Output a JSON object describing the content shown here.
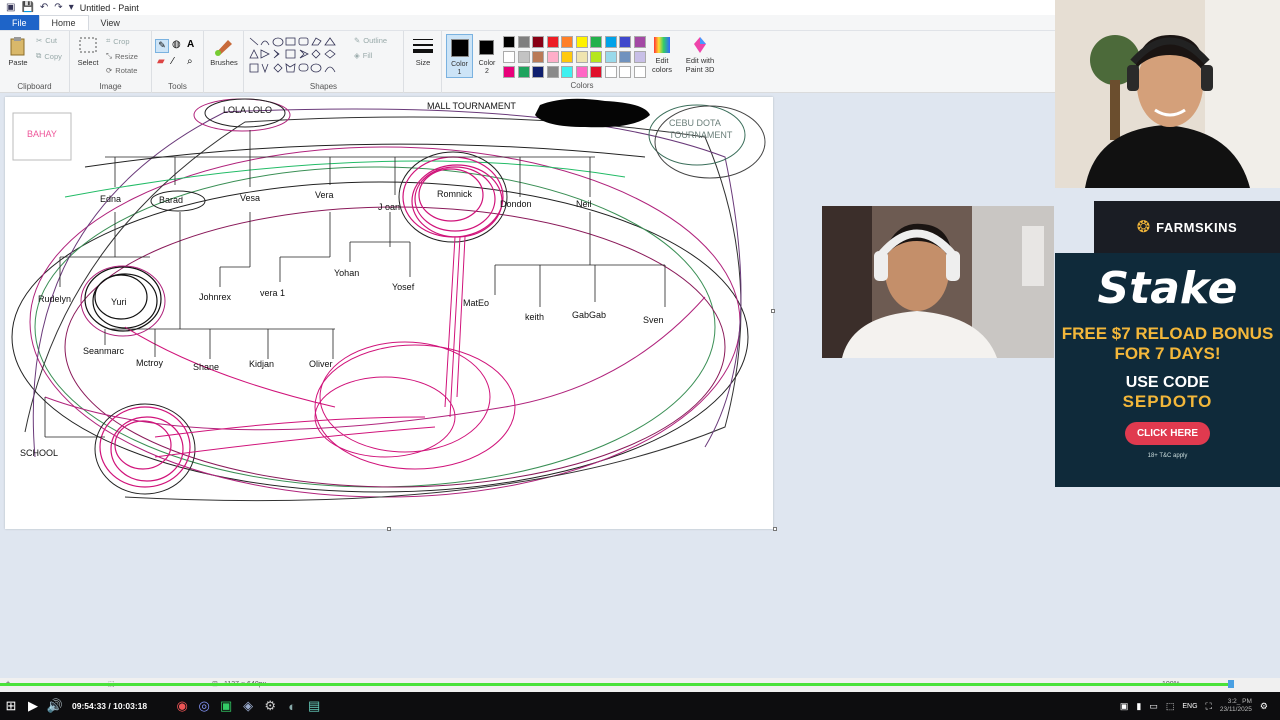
{
  "window": {
    "title": "Untitled - Paint"
  },
  "menu": {
    "file": "File",
    "home": "Home",
    "view": "View"
  },
  "ribbon": {
    "clipboard": {
      "label": "Clipboard",
      "paste": "Paste",
      "cut": "Cut",
      "copy": "Copy"
    },
    "image": {
      "label": "Image",
      "select": "Select",
      "crop": "Crop",
      "resize": "Resize",
      "rotate": "Rotate"
    },
    "tools": {
      "label": "Tools"
    },
    "brushes": "Brushes",
    "shapes": {
      "label": "Shapes",
      "outline": "Outline",
      "fill": "Fill"
    },
    "size": "Size",
    "color1": "Color\n1",
    "color2": "Color\n2",
    "colors": {
      "label": "Colors",
      "edit": "Edit colors",
      "edit_3d": "Edit with Paint 3D",
      "palette": [
        "#000000",
        "#7f7f7f",
        "#880015",
        "#ed1c24",
        "#ff7f27",
        "#fff200",
        "#22b14c",
        "#00a2e8",
        "#3f48cc",
        "#a349a4",
        "#ffffff",
        "#c3c3c3",
        "#b97a57",
        "#ffaec9",
        "#ffc90e",
        "#efe4b0",
        "#b5e61d",
        "#99d9ea",
        "#7092be",
        "#c8bfe7",
        "#e8007a",
        "#1fa35e",
        "#0f1f6e",
        "#8a8a8a",
        "#3ef0f0",
        "#ff66c4",
        "#e0102a",
        "#ffffff",
        "#ffffff",
        "#ffffff"
      ]
    }
  },
  "canvas_labels": {
    "lola_lolo": "LOLA LOLO",
    "mall_tournament": "MALL TOURNAMENT",
    "bahay": "BAHAY",
    "cebu": "CEBU DOTA\nTOURNAMENT",
    "edna": "Edna",
    "barad": "Barad",
    "vesa": "Vesa",
    "vera": "Vera",
    "joan": "J oan",
    "romnick": "Romnick",
    "dondon": "Dondon",
    "neil": "Neil",
    "yohan": "Yohan",
    "yosef": "Yosef",
    "rudelyn": "Rudelyn",
    "yuri": "Yuri",
    "johnrex": "Johnrex",
    "vera1": "vera 1",
    "mateo": "MatEo",
    "keith": "keith",
    "gabgab": "GabGab",
    "sven": "Sven",
    "seanmarc": "Seanmarc",
    "mctroy": "Mctroy",
    "shane": "Shane",
    "kidjan": "Kidjan",
    "oliver": "Oliver",
    "school": "SCHOOL"
  },
  "status": {
    "dimensions": "1137 × 640px",
    "zoom": "100%"
  },
  "ads": {
    "farmskins": "FARMSKINS",
    "stake_logo": "Stake",
    "offer": "FREE $7 RELOAD BONUS FOR 7 DAYS!",
    "use_code": "USE CODE",
    "code": "SEPDOTO",
    "cta": "CLICK HERE",
    "fine": "18+ T&C apply"
  },
  "player": {
    "time": "09:54:33 / 10:03:18",
    "progress": 0.96,
    "lang": "ENG",
    "clock": "3:2_ PM\n23/11/2025"
  }
}
